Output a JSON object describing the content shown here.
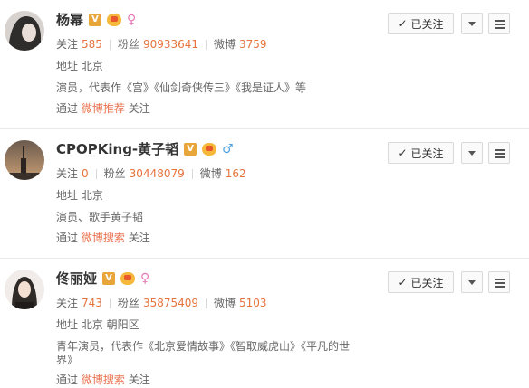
{
  "users": [
    {
      "name": "杨幂",
      "gender": "female",
      "gender_symbol": "♀",
      "follow_label": "关注",
      "follow_count": "585",
      "fans_label": "粉丝",
      "fans_count": "90933641",
      "weibo_label": "微博",
      "weibo_count": "3759",
      "location_label": "地址",
      "location": "北京",
      "desc": "演员，代表作《宫》《仙剑奇侠传三》《我是证人》等",
      "via_prefix": "通过",
      "via_link": "微博推荐",
      "via_suffix": "关注",
      "button_label": "已关注",
      "avatar_colors": [
        "#3a3a3a",
        "#d8d2cf"
      ]
    },
    {
      "name": "CPOPKing-黄子韬",
      "gender": "male",
      "gender_symbol": "♂",
      "follow_label": "关注",
      "follow_count": "0",
      "fans_label": "粉丝",
      "fans_count": "30448079",
      "weibo_label": "微博",
      "weibo_count": "162",
      "location_label": "地址",
      "location": "北京",
      "desc": "演员、歌手黄子韬",
      "via_prefix": "通过",
      "via_link": "微博搜索",
      "via_suffix": "关注",
      "button_label": "已关注",
      "avatar_colors": [
        "#4a4038",
        "#c9a37a"
      ]
    },
    {
      "name": "佟丽娅",
      "gender": "female",
      "gender_symbol": "♀",
      "follow_label": "关注",
      "follow_count": "743",
      "fans_label": "粉丝",
      "fans_count": "35875409",
      "weibo_label": "微博",
      "weibo_count": "5103",
      "location_label": "地址",
      "location": "北京 朝阳区",
      "desc_line1": "青年演员，代表作《北京爱情故事》《智取威虎山》《平凡的世",
      "desc_line2": "界》",
      "via_prefix": "通过",
      "via_link": "微博搜索",
      "via_suffix": "关注",
      "button_label": "已关注",
      "avatar_colors": [
        "#f1ecea",
        "#2e2a28"
      ]
    }
  ],
  "badges": {
    "verified_letter": "V"
  },
  "icons": {
    "follow_check": "✓",
    "dropdown": "chevron-down-icon",
    "menu": "menu-icon"
  },
  "colors": {
    "accent": "#eb7350",
    "count": "#e6733c",
    "verified": "#e8a53a"
  }
}
